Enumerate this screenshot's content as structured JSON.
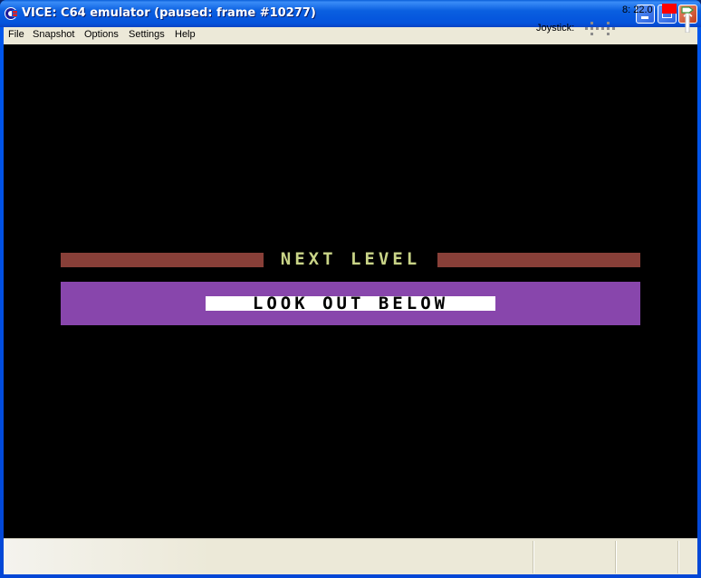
{
  "window": {
    "title": "VICE: C64 emulator (paused: frame #10277)",
    "icon": "vice-c64-logo-icon",
    "controls": [
      "minimize",
      "maximize",
      "close"
    ]
  },
  "menu": {
    "items": [
      {
        "label": "File"
      },
      {
        "label": "Snapshot"
      },
      {
        "label": "Options"
      },
      {
        "label": "Settings"
      },
      {
        "label": "Help"
      }
    ]
  },
  "screen": {
    "heading": "NEXT LEVEL",
    "message": "LOOK OUT BELOW",
    "colors": {
      "background": "#000000",
      "bar": "#883f38",
      "heading_text": "#c9d487",
      "panel": "#8846ac",
      "message_box": "#ffffff",
      "message_text": "#000000"
    }
  },
  "statusbar": {
    "joystick_label": "Joystick:",
    "drive_status": "8: 22.0",
    "drive_led_color": "#ff0000"
  }
}
